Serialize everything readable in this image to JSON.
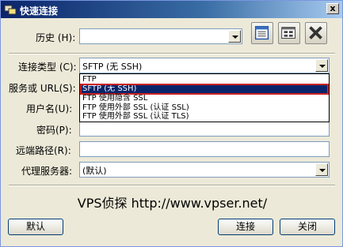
{
  "window": {
    "title": "快速连接",
    "close_glyph": "x"
  },
  "form": {
    "history_label": "历史 (H):",
    "history_value": "",
    "conn_type_label": "连接类型 (C):",
    "conn_type_value": "SFTP (无 SSH)",
    "server_label": "服务或 URL(S):",
    "server_value": "",
    "username_label": "用户名(U):",
    "username_value": "",
    "password_label": "密码(P):",
    "password_value": "",
    "remote_path_label": "远端路径(R):",
    "remote_path_value": "",
    "proxy_label": "代理服务器:",
    "proxy_value": "(默认)"
  },
  "dropdown": {
    "options": [
      "FTP",
      "SFTP (无 SSH)",
      "FTP 使用隐含 SSL",
      "FTP 使用外部 SSL (认证 SSL)",
      "FTP 使用外部 SSL (认证 TLS)"
    ],
    "selected_index": 1
  },
  "watermark": "VPS侦探 http://www.vpser.net/",
  "buttons": {
    "default": "默认",
    "connect": "连接",
    "close": "关闭"
  },
  "icons": {
    "app": "connect-icon",
    "tool1": "bookmark-list-icon",
    "tool2": "site-manager-icon",
    "tool3": "delete-icon"
  }
}
